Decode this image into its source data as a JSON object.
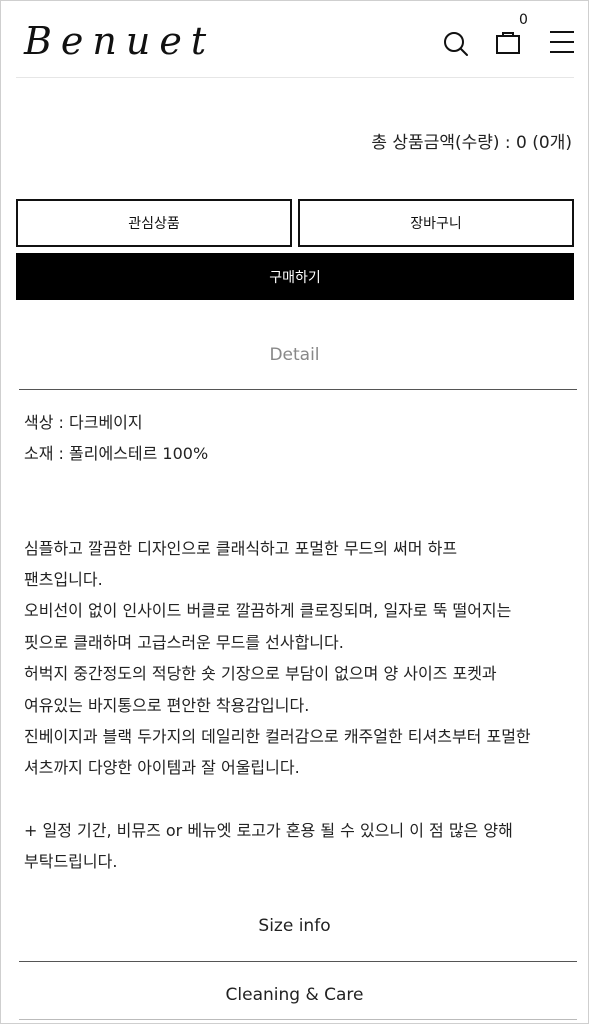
{
  "header": {
    "logo": "Benuet",
    "cart_count": "0"
  },
  "summary": {
    "total_text": "총 상품금액(수량) : 0 (0개)"
  },
  "actions": {
    "wishlist": "관심상품",
    "cart": "장바구니",
    "buy": "구매하기"
  },
  "tabs": {
    "detail": "Detail",
    "size_info": "Size info",
    "cleaning_care": "Cleaning & Care"
  },
  "description": {
    "color": "색상 : 다크베이지",
    "material": "소재 : 폴리에스테르 100%",
    "lines": [
      "심플하고 깔끔한 디자인으로 클래식하고 포멀한 무드의 써머 하프",
      "팬츠입니다.",
      "오비선이 없이 인사이드 버클로 깔끔하게 클로징되며, 일자로 뚝 떨어지는",
      "핏으로 클래하며 고급스러운 무드를 선사합니다.",
      "허벅지 중간정도의 적당한 숏 기장으로 부담이 없으며 양 사이즈 포켓과",
      "여유있는 바지통으로 편안한 착용감입니다.",
      "진베이지과 블랙 두가지의 데일리한 컬러감으로 캐주얼한 티셔츠부터 포멀한",
      "셔츠까지 다양한 아이템과 잘 어울립니다."
    ],
    "note_lines": [
      "+ 일정 기간, 비뮤즈 or 베뉴엣 로고가 혼용 될 수 있으니 이 점 많은 양해",
      "부탁드립니다."
    ]
  },
  "colors": {
    "primary_button": "#000000",
    "muted_text": "#888888"
  }
}
